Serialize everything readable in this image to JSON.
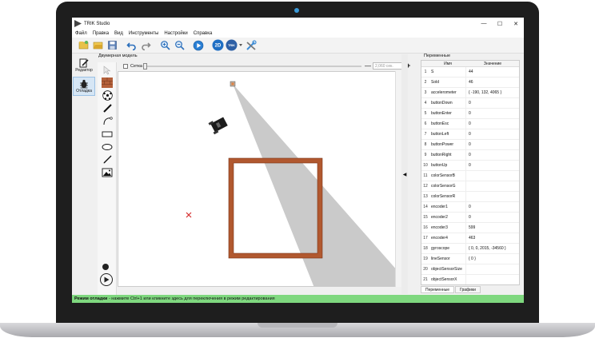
{
  "window": {
    "title": "TRIK Studio",
    "controls": [
      "—",
      "☐",
      "✕"
    ]
  },
  "menu": [
    "Файл",
    "Правка",
    "Вид",
    "Инструменты",
    "Настройки",
    "Справка"
  ],
  "toolbar": {
    "icons": [
      "new-icon",
      "open-icon",
      "save-icon",
      "undo-icon",
      "redo-icon",
      "zoom-in-icon",
      "zoom-out-icon",
      "run-icon",
      "2d-model-icon",
      "trik-icon",
      "settings-icon"
    ],
    "mode_2d_label": "2D",
    "trik_label": "TRIK"
  },
  "modes": {
    "editor_label": "Редактор",
    "debug_label": "Отладка"
  },
  "scene": {
    "title": "Двумерная модель",
    "grid_label": "Сетка",
    "speed_placeholder": "2,060 сек."
  },
  "variables": {
    "title": "Переменные",
    "col_name": "Имя",
    "col_value": "Значение",
    "rows": [
      {
        "n": "1",
        "name": "S",
        "value": "44"
      },
      {
        "n": "2",
        "name": "Sold",
        "value": "46"
      },
      {
        "n": "3",
        "name": "accelerometer",
        "value": "{ -190, 132, 4065 }"
      },
      {
        "n": "4",
        "name": "buttonDown",
        "value": "0"
      },
      {
        "n": "5",
        "name": "buttonEnter",
        "value": "0"
      },
      {
        "n": "6",
        "name": "buttonEsc",
        "value": "0"
      },
      {
        "n": "7",
        "name": "buttonLeft",
        "value": "0"
      },
      {
        "n": "8",
        "name": "buttonPower",
        "value": "0"
      },
      {
        "n": "9",
        "name": "buttonRight",
        "value": "0"
      },
      {
        "n": "10",
        "name": "buttonUp",
        "value": "0"
      },
      {
        "n": "11",
        "name": "colorSensorB",
        "value": ""
      },
      {
        "n": "12",
        "name": "colorSensorG",
        "value": ""
      },
      {
        "n": "13",
        "name": "colorSensorR",
        "value": ""
      },
      {
        "n": "14",
        "name": "encoder1",
        "value": "0"
      },
      {
        "n": "15",
        "name": "encoder2",
        "value": "0"
      },
      {
        "n": "16",
        "name": "encoder3",
        "value": "599"
      },
      {
        "n": "17",
        "name": "encoder4",
        "value": "463"
      },
      {
        "n": "18",
        "name": "gyroscope",
        "value": "{ 0, 0, 2015, -34560 }"
      },
      {
        "n": "19",
        "name": "lineSensor",
        "value": "{ 0 }"
      },
      {
        "n": "20",
        "name": "objectSensorSize",
        "value": ""
      },
      {
        "n": "21",
        "name": "objectSensorX",
        "value": ""
      }
    ]
  },
  "tabs": [
    "Переменные",
    "Графики"
  ],
  "status": {
    "bold": "Режим отладки",
    "text": " - нажмите Ctrl+1 или кликните здесь для переключения в режим редактирования"
  }
}
